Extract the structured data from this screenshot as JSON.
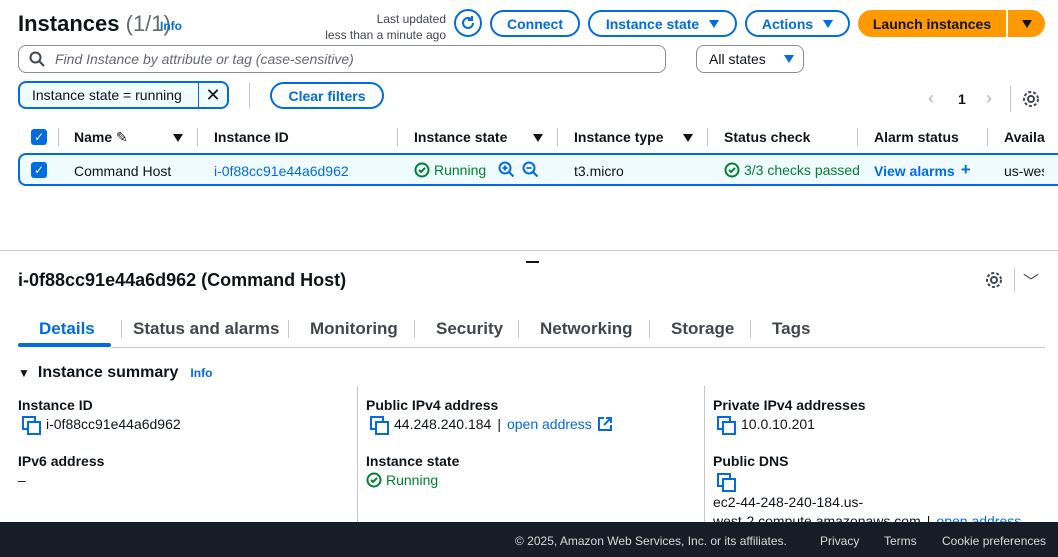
{
  "header": {
    "title": "Instances",
    "count": "(1/1)",
    "info": "Info",
    "last_updated_line1": "Last updated",
    "last_updated_line2": "less than a minute ago",
    "connect": "Connect",
    "instance_state": "Instance state",
    "actions": "Actions",
    "launch": "Launch instances"
  },
  "search": {
    "placeholder": "Find Instance by attribute or tag (case-sensitive)",
    "states_select": "All states"
  },
  "filters": {
    "token": "Instance state = running",
    "clear": "Clear filters"
  },
  "pagination": {
    "page": "1"
  },
  "table": {
    "columns": [
      "Name",
      "Instance ID",
      "Instance state",
      "Instance type",
      "Status check",
      "Alarm status",
      "Availa"
    ],
    "row": {
      "name": "Command Host",
      "id": "i-0f88cc91e44a6d962",
      "state": "Running",
      "type": "t3.micro",
      "status": "3/3 checks passed",
      "alarm": "View alarms",
      "az": "us-west"
    }
  },
  "detail": {
    "title": "i-0f88cc91e44a6d962 (Command Host)",
    "tabs": [
      "Details",
      "Status and alarms",
      "Monitoring",
      "Security",
      "Networking",
      "Storage",
      "Tags"
    ],
    "summary": "Instance summary",
    "info": "Info",
    "instance_id_label": "Instance ID",
    "instance_id_value": "i-0f88cc91e44a6d962",
    "ipv6_label": "IPv6 address",
    "ipv6_value": "–",
    "public_ipv4_label": "Public IPv4 address",
    "public_ipv4_value": "44.248.240.184",
    "open_address": "open address",
    "state_label": "Instance state",
    "state_value": "Running",
    "private_ipv4_label": "Private IPv4 addresses",
    "private_ipv4_value": "10.0.10.201",
    "public_dns_label": "Public DNS",
    "public_dns_line1": "ec2-44-248-240-184.us-",
    "public_dns_line2": "west-2.compute.amazonaws.com",
    "open_address2": "open address"
  },
  "footer": {
    "copyright": "© 2025, Amazon Web Services, Inc. or its affiliates.",
    "privacy": "Privacy",
    "terms": "Terms",
    "cookies": "Cookie preferences"
  },
  "colors": {
    "accent": "#006ce0",
    "launch": "#ff9900",
    "success": "#00802f",
    "footer": "#161d26"
  }
}
